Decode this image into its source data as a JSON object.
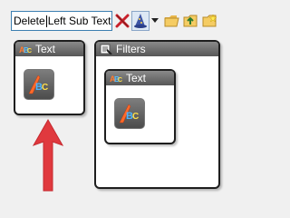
{
  "toolbar": {
    "search_value": "Delete",
    "search_value_after_caret": "Left Sub Text",
    "icons": [
      "delete-x-icon",
      "wizard-hat-icon",
      "dropdown-arrow-icon",
      "folder-open-icon",
      "folder-up-icon",
      "folder-new-icon"
    ]
  },
  "panels": {
    "text_panel": {
      "title": "Text",
      "icon": "text-style-icon"
    },
    "filters_panel": {
      "title": "Filters",
      "icon": "filters-icon"
    },
    "nested_text_panel": {
      "title": "Text",
      "icon": "text-style-icon"
    }
  },
  "colors": {
    "arrow": "#e0393e",
    "panel_header_top": "#8a8a8a",
    "panel_header_bottom": "#575757",
    "search_border": "#3c7fb1"
  }
}
